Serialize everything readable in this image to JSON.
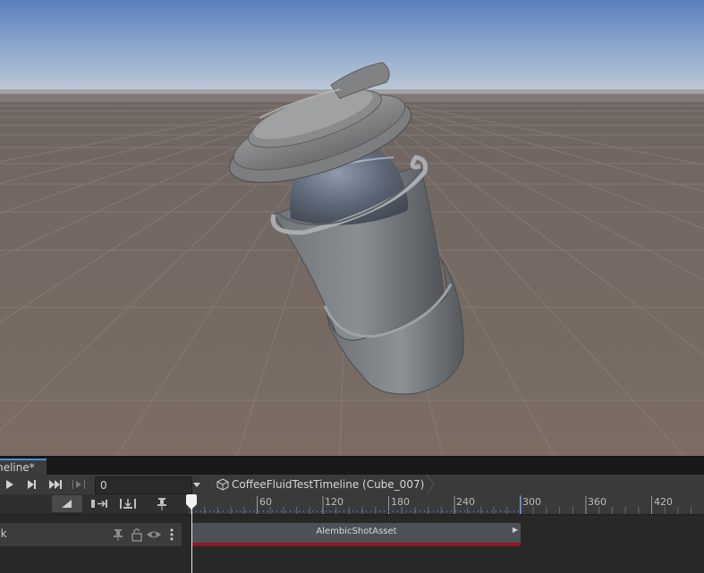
{
  "window": {
    "tab_title": "meline*"
  },
  "toolbar": {
    "frame_value": "0",
    "breadcrumb": "CoffeeFluidTestTimeline (Cube_007)"
  },
  "ruler": {
    "ticks": [
      "60",
      "120",
      "180",
      "240",
      "300",
      "360",
      "420"
    ]
  },
  "track": {
    "name": "ck",
    "clip_label": "AlembicShotAsset"
  },
  "colors": {
    "sky": "#aebfd0",
    "ground": "#756861",
    "clip_bar": "#8e1920",
    "accent": "#4a90d9"
  }
}
